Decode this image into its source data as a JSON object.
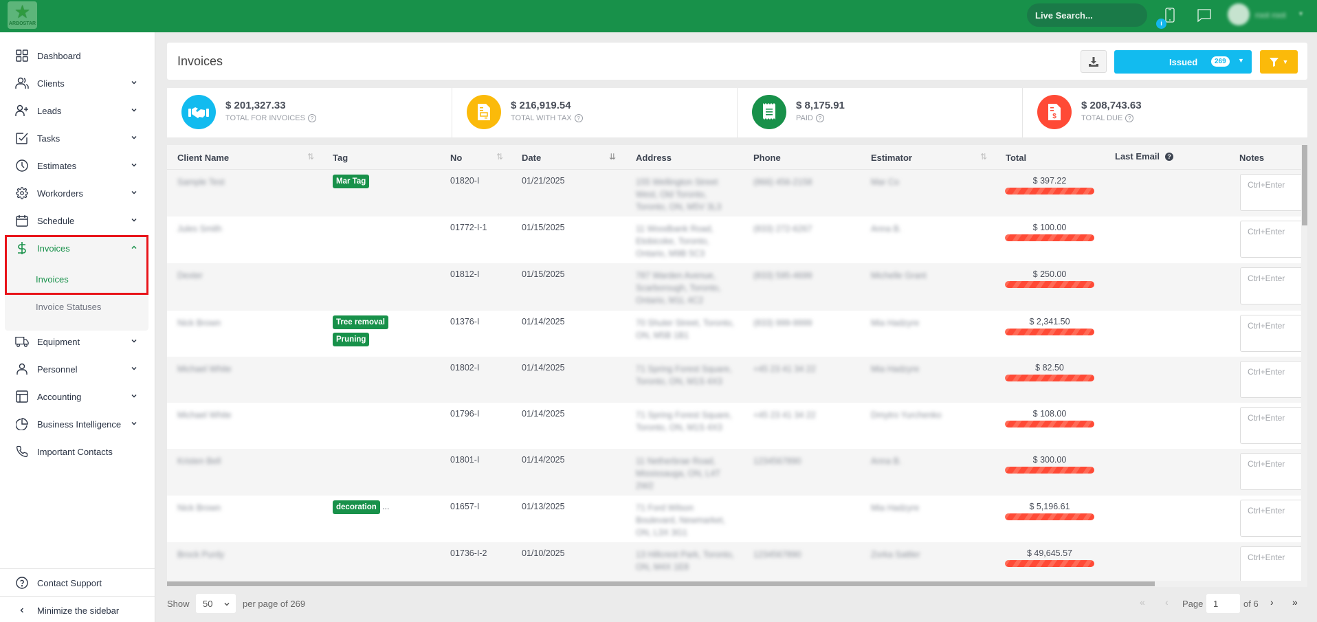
{
  "app": {
    "logo_text": "ARBOSTAR",
    "live_search_placeholder": "Live Search...",
    "notification_badge": "i",
    "user_name": "root root"
  },
  "sidebar": {
    "items": [
      {
        "label": "Dashboard",
        "icon": "grid-icon",
        "has_chevron": false
      },
      {
        "label": "Clients",
        "icon": "users-icon",
        "has_chevron": true
      },
      {
        "label": "Leads",
        "icon": "user-plus-icon",
        "has_chevron": true
      },
      {
        "label": "Tasks",
        "icon": "checkbox-icon",
        "has_chevron": true
      },
      {
        "label": "Estimates",
        "icon": "clock-icon",
        "has_chevron": true
      },
      {
        "label": "Workorders",
        "icon": "gear-icon",
        "has_chevron": true
      },
      {
        "label": "Schedule",
        "icon": "calendar-icon",
        "has_chevron": true
      },
      {
        "label": "Invoices",
        "icon": "dollar-icon",
        "has_chevron": true,
        "expanded": true,
        "active": true
      },
      {
        "label": "Equipment",
        "icon": "truck-icon",
        "has_chevron": true
      },
      {
        "label": "Personnel",
        "icon": "person-icon",
        "has_chevron": true
      },
      {
        "label": "Accounting",
        "icon": "table-icon",
        "has_chevron": true
      },
      {
        "label": "Business Intelligence",
        "icon": "pie-chart-icon",
        "has_chevron": true
      },
      {
        "label": "Important Contacts",
        "icon": "phone-icon",
        "has_chevron": false
      }
    ],
    "invoices_sub": [
      {
        "label": "Invoices",
        "active": true
      },
      {
        "label": "Invoice Statuses",
        "active": false
      }
    ],
    "contact_support": "Contact Support",
    "minimize": "Minimize the sidebar"
  },
  "header": {
    "title": "Invoices",
    "status_button": "Issued",
    "status_count": "269"
  },
  "stats": [
    {
      "value": "$ 201,327.33",
      "label": "TOTAL FOR INVOICES",
      "color": "#12bbef",
      "icon": "handshake-icon"
    },
    {
      "value": "$ 216,919.54",
      "label": "TOTAL WITH TAX",
      "color": "#fbba0a",
      "icon": "document-icon"
    },
    {
      "value": "$ 8,175.91",
      "label": "PAID",
      "color": "#18914a",
      "icon": "receipt-icon"
    },
    {
      "value": "$ 208,743.63",
      "label": "TOTAL DUE",
      "color": "#ff4a36",
      "icon": "invoice-dollar-icon"
    }
  ],
  "table": {
    "columns": [
      "Client Name",
      "Tag",
      "No",
      "Date",
      "Address",
      "Phone",
      "Estimator",
      "Total",
      "Last Email",
      "Notes"
    ],
    "notes_placeholder": "Ctrl+Enter",
    "rows": [
      {
        "client": "Sample Test",
        "tags": [
          "Mar Tag"
        ],
        "more": "",
        "no": "01820-I",
        "date": "01/21/2025",
        "address": "155 Wellington Street West, Old Toronto, Toronto, ON, M5V 3L3",
        "phone": "(866) 456-2158",
        "estimator": "Mar Co",
        "total": "$ 397.22",
        "paid_fraction": 0
      },
      {
        "client": "Jules Smith",
        "tags": [],
        "more": "",
        "no": "01772-I-1",
        "date": "01/15/2025",
        "address": "11 Woodbank Road, Etobicoke, Toronto, Ontario, M9B 5C3",
        "phone": "(833) 272-6267",
        "estimator": "Anna B.",
        "total": "$ 100.00",
        "paid_fraction": 0
      },
      {
        "client": "Dexter",
        "tags": [],
        "more": "",
        "no": "01812-I",
        "date": "01/15/2025",
        "address": "787 Warden Avenue, Scarborough, Toronto, Ontario, M1L 4C2",
        "phone": "(833) 595-4699",
        "estimator": "Michelle Grant",
        "total": "$ 250.00",
        "paid_fraction": 0
      },
      {
        "client": "Nick Brown",
        "tags": [
          "Tree removal",
          "Pruning"
        ],
        "more": "",
        "no": "01376-I",
        "date": "01/14/2025",
        "address": "70 Shuter Street, Toronto, ON, M5B 1B1",
        "phone": "(833) 999-9999",
        "estimator": "Mia Hadzyre",
        "total": "$ 2,341.50",
        "paid_fraction": 0
      },
      {
        "client": "Michael White",
        "tags": [],
        "more": "",
        "no": "01802-I",
        "date": "01/14/2025",
        "address": "71 Spring Forest Square, Toronto, ON, M1S 4X3",
        "phone": "+45 23 41 34 22",
        "estimator": "Mia Hadzyre",
        "total": "$ 82.50",
        "paid_fraction": 0
      },
      {
        "client": "Michael White",
        "tags": [],
        "more": "",
        "no": "01796-I",
        "date": "01/14/2025",
        "address": "71 Spring Forest Square, Toronto, ON, M1S 4X3",
        "phone": "+45 23 41 34 22",
        "estimator": "Dmytro Yurchenko",
        "total": "$ 108.00",
        "paid_fraction": 0
      },
      {
        "client": "Kristen Bell",
        "tags": [],
        "more": "",
        "no": "01801-I",
        "date": "01/14/2025",
        "address": "11 Netherbrae Road, Mississauga, ON, L4T 2W2",
        "phone": "1234567890",
        "estimator": "Anna B.",
        "total": "$ 300.00",
        "paid_fraction": 0
      },
      {
        "client": "Nick Brown",
        "tags": [
          "decoration"
        ],
        "more": "...",
        "no": "01657-I",
        "date": "01/13/2025",
        "address": "71 Ford Wilson Boulevard, Newmarket, ON, L3X 3G1",
        "phone": "",
        "estimator": "Mia Hadzyre",
        "total": "$ 5,196.61",
        "paid_fraction": 0
      },
      {
        "client": "Brock Purdy",
        "tags": [],
        "more": "",
        "no": "01736-I-2",
        "date": "01/10/2025",
        "address": "13 Hillcrest Park, Toronto, ON, M4X 1E8",
        "phone": "1234567890",
        "estimator": "Zorka Sattler",
        "total": "$ 49,645.57",
        "paid_fraction": 0
      }
    ]
  },
  "footer": {
    "show_label": "Show",
    "per_page_value": "50",
    "per_page_suffix": "per page of 269",
    "page_label": "Page",
    "page_value": "1",
    "page_of": "of 6"
  }
}
